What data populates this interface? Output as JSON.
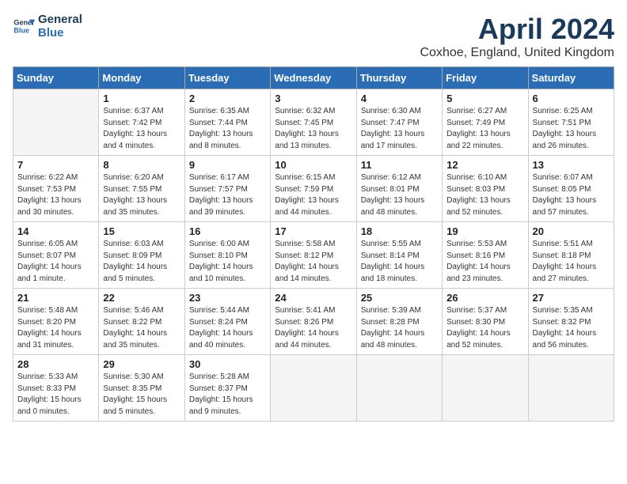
{
  "logo": {
    "line1": "General",
    "line2": "Blue"
  },
  "title": "April 2024",
  "location": "Coxhoe, England, United Kingdom",
  "weekdays": [
    "Sunday",
    "Monday",
    "Tuesday",
    "Wednesday",
    "Thursday",
    "Friday",
    "Saturday"
  ],
  "weeks": [
    [
      {
        "day": "",
        "content": ""
      },
      {
        "day": "1",
        "content": "Sunrise: 6:37 AM\nSunset: 7:42 PM\nDaylight: 13 hours\nand 4 minutes."
      },
      {
        "day": "2",
        "content": "Sunrise: 6:35 AM\nSunset: 7:44 PM\nDaylight: 13 hours\nand 8 minutes."
      },
      {
        "day": "3",
        "content": "Sunrise: 6:32 AM\nSunset: 7:45 PM\nDaylight: 13 hours\nand 13 minutes."
      },
      {
        "day": "4",
        "content": "Sunrise: 6:30 AM\nSunset: 7:47 PM\nDaylight: 13 hours\nand 17 minutes."
      },
      {
        "day": "5",
        "content": "Sunrise: 6:27 AM\nSunset: 7:49 PM\nDaylight: 13 hours\nand 22 minutes."
      },
      {
        "day": "6",
        "content": "Sunrise: 6:25 AM\nSunset: 7:51 PM\nDaylight: 13 hours\nand 26 minutes."
      }
    ],
    [
      {
        "day": "7",
        "content": "Sunrise: 6:22 AM\nSunset: 7:53 PM\nDaylight: 13 hours\nand 30 minutes."
      },
      {
        "day": "8",
        "content": "Sunrise: 6:20 AM\nSunset: 7:55 PM\nDaylight: 13 hours\nand 35 minutes."
      },
      {
        "day": "9",
        "content": "Sunrise: 6:17 AM\nSunset: 7:57 PM\nDaylight: 13 hours\nand 39 minutes."
      },
      {
        "day": "10",
        "content": "Sunrise: 6:15 AM\nSunset: 7:59 PM\nDaylight: 13 hours\nand 44 minutes."
      },
      {
        "day": "11",
        "content": "Sunrise: 6:12 AM\nSunset: 8:01 PM\nDaylight: 13 hours\nand 48 minutes."
      },
      {
        "day": "12",
        "content": "Sunrise: 6:10 AM\nSunset: 8:03 PM\nDaylight: 13 hours\nand 52 minutes."
      },
      {
        "day": "13",
        "content": "Sunrise: 6:07 AM\nSunset: 8:05 PM\nDaylight: 13 hours\nand 57 minutes."
      }
    ],
    [
      {
        "day": "14",
        "content": "Sunrise: 6:05 AM\nSunset: 8:07 PM\nDaylight: 14 hours\nand 1 minute."
      },
      {
        "day": "15",
        "content": "Sunrise: 6:03 AM\nSunset: 8:09 PM\nDaylight: 14 hours\nand 5 minutes."
      },
      {
        "day": "16",
        "content": "Sunrise: 6:00 AM\nSunset: 8:10 PM\nDaylight: 14 hours\nand 10 minutes."
      },
      {
        "day": "17",
        "content": "Sunrise: 5:58 AM\nSunset: 8:12 PM\nDaylight: 14 hours\nand 14 minutes."
      },
      {
        "day": "18",
        "content": "Sunrise: 5:55 AM\nSunset: 8:14 PM\nDaylight: 14 hours\nand 18 minutes."
      },
      {
        "day": "19",
        "content": "Sunrise: 5:53 AM\nSunset: 8:16 PM\nDaylight: 14 hours\nand 23 minutes."
      },
      {
        "day": "20",
        "content": "Sunrise: 5:51 AM\nSunset: 8:18 PM\nDaylight: 14 hours\nand 27 minutes."
      }
    ],
    [
      {
        "day": "21",
        "content": "Sunrise: 5:48 AM\nSunset: 8:20 PM\nDaylight: 14 hours\nand 31 minutes."
      },
      {
        "day": "22",
        "content": "Sunrise: 5:46 AM\nSunset: 8:22 PM\nDaylight: 14 hours\nand 35 minutes."
      },
      {
        "day": "23",
        "content": "Sunrise: 5:44 AM\nSunset: 8:24 PM\nDaylight: 14 hours\nand 40 minutes."
      },
      {
        "day": "24",
        "content": "Sunrise: 5:41 AM\nSunset: 8:26 PM\nDaylight: 14 hours\nand 44 minutes."
      },
      {
        "day": "25",
        "content": "Sunrise: 5:39 AM\nSunset: 8:28 PM\nDaylight: 14 hours\nand 48 minutes."
      },
      {
        "day": "26",
        "content": "Sunrise: 5:37 AM\nSunset: 8:30 PM\nDaylight: 14 hours\nand 52 minutes."
      },
      {
        "day": "27",
        "content": "Sunrise: 5:35 AM\nSunset: 8:32 PM\nDaylight: 14 hours\nand 56 minutes."
      }
    ],
    [
      {
        "day": "28",
        "content": "Sunrise: 5:33 AM\nSunset: 8:33 PM\nDaylight: 15 hours\nand 0 minutes."
      },
      {
        "day": "29",
        "content": "Sunrise: 5:30 AM\nSunset: 8:35 PM\nDaylight: 15 hours\nand 5 minutes."
      },
      {
        "day": "30",
        "content": "Sunrise: 5:28 AM\nSunset: 8:37 PM\nDaylight: 15 hours\nand 9 minutes."
      },
      {
        "day": "",
        "content": ""
      },
      {
        "day": "",
        "content": ""
      },
      {
        "day": "",
        "content": ""
      },
      {
        "day": "",
        "content": ""
      }
    ]
  ]
}
